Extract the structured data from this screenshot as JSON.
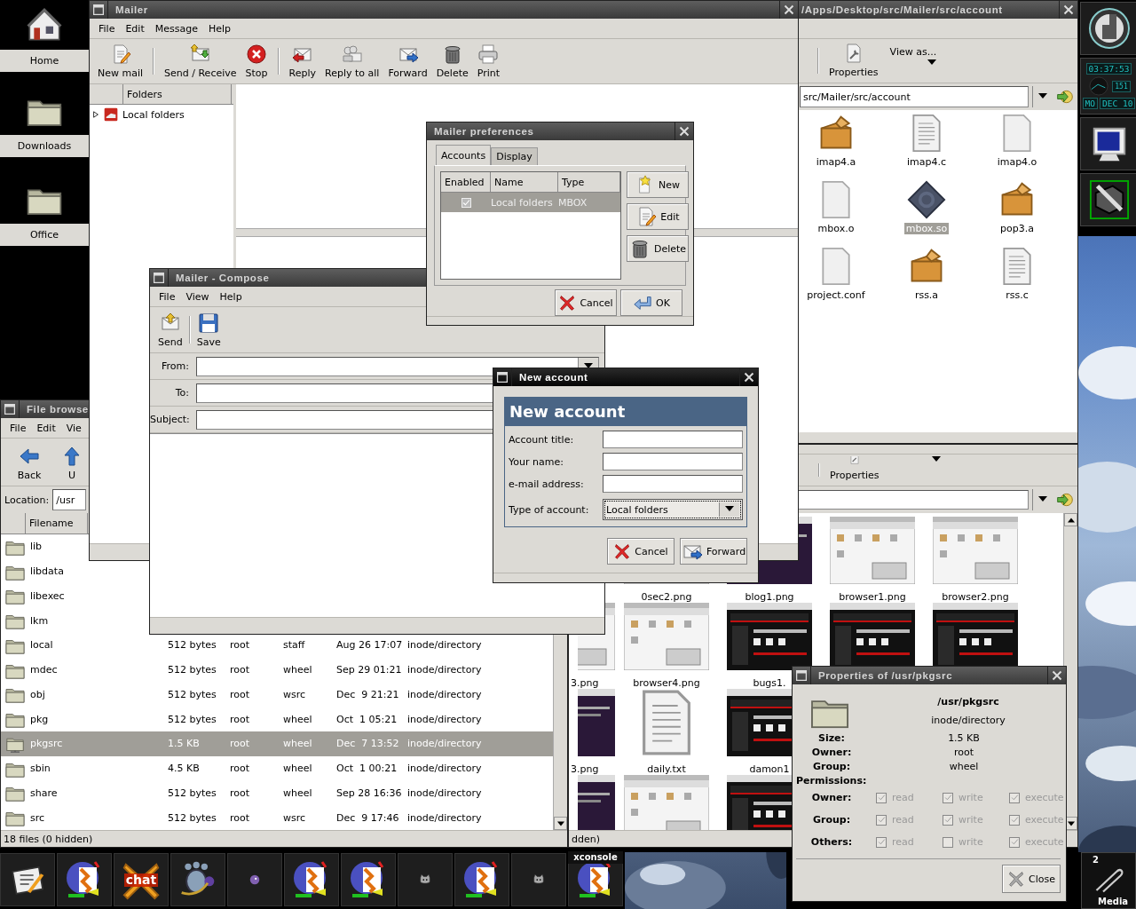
{
  "desktop_icons": [
    {
      "kind": "home",
      "label": "Home"
    },
    {
      "kind": "folder",
      "label": "Downloads"
    },
    {
      "kind": "folder",
      "label": "Office"
    }
  ],
  "thumbs_window": {
    "toolbar": [
      {
        "kind": "properties",
        "label": "Properties"
      }
    ],
    "rows": [
      [
        {
          "kind": "empty"
        },
        {
          "kind": "light",
          "label": "0sec2.png"
        },
        {
          "kind": "dark",
          "label": "blog1.png"
        },
        {
          "kind": "light",
          "label": "browser1.png"
        },
        {
          "kind": "light",
          "label": "browser2.png"
        }
      ],
      [
        {
          "kind": "light",
          "label": "3.png"
        },
        {
          "kind": "light",
          "label": "browser4.png"
        },
        {
          "kind": "web",
          "label": "bugs1."
        },
        {
          "kind": "web"
        },
        {
          "kind": "web"
        }
      ],
      [
        {
          "kind": "dark",
          "label": "3.png"
        },
        {
          "kind": "text",
          "label": "daily.txt"
        },
        {
          "kind": "web",
          "label": "damon1"
        }
      ],
      [
        {
          "kind": "dark"
        },
        {
          "kind": "light"
        },
        {
          "kind": "web"
        }
      ]
    ],
    "status": "dden)"
  },
  "file_browser": {
    "title": "File browse",
    "active": false,
    "menu": [
      "File",
      "Edit",
      "Vie"
    ],
    "toolbar": [
      {
        "kind": "back",
        "label": "Back"
      },
      {
        "kind": "up",
        "label": "U"
      }
    ],
    "location_label": "Location:",
    "location": "/usr",
    "columns": [
      "Filename"
    ],
    "rows": [
      {
        "kind": "folder",
        "name": "lib",
        "selected": false
      },
      {
        "kind": "folder",
        "name": "libdata",
        "selected": false
      },
      {
        "kind": "folder",
        "name": "libexec",
        "selected": false
      },
      {
        "kind": "folder",
        "name": "lkm",
        "selected": false
      },
      {
        "kind": "folder",
        "name": "local",
        "size": "512 bytes",
        "owner": "root",
        "group": "staff",
        "modified": "Aug 26 17:07",
        "type": "inode/directory",
        "selected": false
      },
      {
        "kind": "folder",
        "name": "mdec",
        "size": "512 bytes",
        "owner": "root",
        "group": "wheel",
        "modified": "Sep 29 01:21",
        "type": "inode/directory",
        "selected": false
      },
      {
        "kind": "folder",
        "name": "obj",
        "size": "512 bytes",
        "owner": "root",
        "group": "wsrc",
        "modified": "Dec  9 21:21",
        "type": "inode/directory",
        "selected": false
      },
      {
        "kind": "folder",
        "name": "pkg",
        "size": "512 bytes",
        "owner": "root",
        "group": "wheel",
        "modified": "Oct  1 05:21",
        "type": "inode/directory",
        "selected": false
      },
      {
        "kind": "network-folder",
        "name": "pkgsrc",
        "size": "1.5 KB",
        "owner": "root",
        "group": "wheel",
        "modified": "Dec  7 13:52",
        "type": "inode/directory",
        "selected": true
      },
      {
        "kind": "folder",
        "name": "sbin",
        "size": "4.5 KB",
        "owner": "root",
        "group": "wheel",
        "modified": "Oct  1 00:21",
        "type": "inode/directory",
        "selected": false
      },
      {
        "kind": "folder",
        "name": "share",
        "size": "512 bytes",
        "owner": "root",
        "group": "wheel",
        "modified": "Sep 28 16:36",
        "type": "inode/directory",
        "selected": false
      },
      {
        "kind": "folder",
        "name": "src",
        "size": "512 bytes",
        "owner": "root",
        "group": "wsrc",
        "modified": "Dec  9 17:46",
        "type": "inode/directory",
        "selected": false
      }
    ],
    "status": "18 files (0 hidden)"
  },
  "account_browser": {
    "title": "/Apps/Desktop/src/Mailer/src/account",
    "active": false,
    "toolbar": [
      {
        "kind": "properties",
        "label": "Properties"
      }
    ],
    "view_menu": "View as...",
    "location": "src/Mailer/src/account",
    "files": [
      {
        "kind": "archive",
        "name": "imap4.a",
        "selected": false
      },
      {
        "kind": "text",
        "name": "imap4.c",
        "selected": false
      },
      {
        "kind": "blank",
        "name": "imap4.o",
        "selected": false
      },
      {
        "kind": "blank",
        "name": "mbox.o",
        "selected": false
      },
      {
        "kind": "library",
        "name": "mbox.so",
        "selected": true
      },
      {
        "kind": "archive",
        "name": "pop3.a",
        "selected": false
      },
      {
        "kind": "blank",
        "name": "project.conf",
        "selected": false
      },
      {
        "kind": "archive",
        "name": "rss.a",
        "selected": false
      },
      {
        "kind": "text",
        "name": "rss.c",
        "selected": false
      }
    ]
  },
  "mailer": {
    "title": "Mailer",
    "active": false,
    "menu": [
      "File",
      "Edit",
      "Message",
      "Help"
    ],
    "toolbar": [
      [
        {
          "kind": "new-mail",
          "label": "New mail"
        }
      ],
      [
        {
          "kind": "send-receive",
          "label": "Send / Receive"
        },
        {
          "kind": "stop",
          "label": "Stop"
        }
      ],
      [
        {
          "kind": "reply",
          "label": "Reply"
        },
        {
          "kind": "reply-all",
          "label": "Reply to all"
        },
        {
          "kind": "forward",
          "label": "Forward"
        },
        {
          "kind": "delete",
          "label": "Delete"
        },
        {
          "kind": "print",
          "label": "Print"
        }
      ]
    ],
    "folders_header": "Folders",
    "folders": [
      {
        "label": "Local folders",
        "expanded": false
      }
    ]
  },
  "compose": {
    "title": "Mailer - Compose",
    "active": false,
    "menu": [
      "File",
      "View",
      "Help"
    ],
    "toolbar": [
      {
        "kind": "send",
        "label": "Send"
      },
      {
        "kind": "save",
        "label": "Save"
      }
    ],
    "fields": [
      {
        "kind": "combo",
        "label": "From:"
      },
      {
        "kind": "text",
        "label": "To:"
      },
      {
        "kind": "text",
        "label": "Subject:"
      }
    ]
  },
  "preferences": {
    "title": "Mailer preferences",
    "active": false,
    "tabs": [
      {
        "label": "Accounts",
        "selected": true
      },
      {
        "label": "Display",
        "selected": false
      }
    ],
    "columns": [
      "Enabled",
      "Name",
      "Type"
    ],
    "accounts": [
      {
        "enabled": true,
        "name": "Local folders",
        "type": "MBOX",
        "selected": true
      }
    ],
    "side_buttons": [
      {
        "kind": "new",
        "label": "New"
      },
      {
        "kind": "edit",
        "label": "Edit"
      },
      {
        "kind": "delete",
        "label": "Delete"
      }
    ],
    "buttons": [
      {
        "kind": "cancel",
        "label": "Cancel"
      },
      {
        "kind": "ok",
        "label": "OK"
      }
    ]
  },
  "new_account": {
    "title": "New account",
    "active": true,
    "heading": "New account",
    "fields": [
      {
        "kind": "text",
        "label": "Account title:"
      },
      {
        "kind": "text",
        "label": "Your name:"
      },
      {
        "kind": "text",
        "label": "e-mail address:"
      },
      {
        "kind": "combo",
        "label": "Type of account:",
        "value": "Local folders"
      }
    ],
    "buttons": [
      {
        "kind": "cancel",
        "label": "Cancel"
      },
      {
        "kind": "forward",
        "label": "Forward"
      }
    ]
  },
  "properties": {
    "title": "Properties of /usr/pkgsrc",
    "active": false,
    "path": "/usr/pkgsrc",
    "mime": "inode/directory",
    "info": [
      {
        "label": "Size:",
        "value": "1.5 KB"
      },
      {
        "label": "Owner:",
        "value": "root"
      },
      {
        "label": "Group:",
        "value": "wheel"
      }
    ],
    "permissions_label": "Permissions:",
    "editable": false,
    "permissions": [
      {
        "label": "Owner:",
        "flags": [
          {
            "label": "read",
            "checked": true
          },
          {
            "label": "write",
            "checked": true
          },
          {
            "label": "execute",
            "checked": true
          }
        ]
      },
      {
        "label": "Group:",
        "flags": [
          {
            "label": "read",
            "checked": true
          },
          {
            "label": "write",
            "checked": true
          },
          {
            "label": "execute",
            "checked": true
          }
        ]
      },
      {
        "label": "Others:",
        "flags": [
          {
            "label": "read",
            "checked": true
          },
          {
            "label": "write",
            "checked": false
          },
          {
            "label": "execute",
            "checked": true
          }
        ]
      }
    ],
    "button": "Close"
  },
  "taskbar": [
    {
      "kind": "notepad"
    },
    {
      "kind": "swirl"
    },
    {
      "kind": "chat",
      "label": "chat"
    },
    {
      "kind": "foot"
    },
    {
      "kind": "bird"
    },
    {
      "kind": "swirl"
    },
    {
      "kind": "swirl"
    },
    {
      "kind": "cat"
    },
    {
      "kind": "swirl"
    },
    {
      "kind": "cat"
    },
    {
      "kind": "swirl",
      "tooltip": "xconsole"
    }
  ],
  "dock": {
    "clock": "03:37:53",
    "seconds": "151",
    "weekday": "MO",
    "date": "DEC 10",
    "media_count": "2",
    "media_label": "Media"
  }
}
